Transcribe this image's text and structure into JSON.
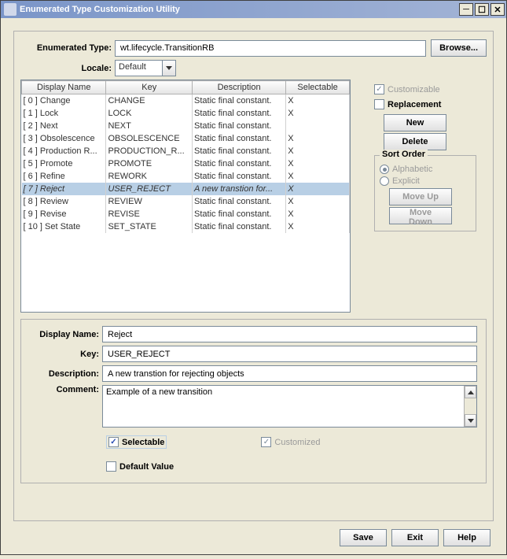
{
  "window": {
    "title": "Enumerated Type Customization Utility"
  },
  "header": {
    "enum_type_label": "Enumerated Type:",
    "enum_type_value": "wt.lifecycle.TransitionRB",
    "browse_label": "Browse...",
    "locale_label": "Locale:",
    "locale_value": "Default"
  },
  "table": {
    "columns": [
      "Display Name",
      "Key",
      "Description",
      "Selectable"
    ],
    "rows": [
      {
        "idx": "0",
        "dn": "Change",
        "key": "CHANGE",
        "desc": "Static final constant.",
        "sel": "X"
      },
      {
        "idx": "1",
        "dn": "Lock",
        "key": "LOCK",
        "desc": "Static final constant.",
        "sel": "X"
      },
      {
        "idx": "2",
        "dn": "Next",
        "key": "NEXT",
        "desc": "Static final constant.",
        "sel": ""
      },
      {
        "idx": "3",
        "dn": "Obsolescence",
        "key": "OBSOLESCENCE",
        "desc": "Static final constant.",
        "sel": "X"
      },
      {
        "idx": "4",
        "dn": "Production R...",
        "key": "PRODUCTION_R...",
        "desc": "Static final constant.",
        "sel": "X"
      },
      {
        "idx": "5",
        "dn": "Promote",
        "key": "PROMOTE",
        "desc": "Static final constant.",
        "sel": "X"
      },
      {
        "idx": "6",
        "dn": "Refine",
        "key": "REWORK",
        "desc": "Static final constant.",
        "sel": "X"
      },
      {
        "idx": "7",
        "dn": "Reject",
        "key": "USER_REJECT",
        "desc": "A new transtion for...",
        "sel": "X"
      },
      {
        "idx": "8",
        "dn": "Review",
        "key": "REVIEW",
        "desc": "Static final constant.",
        "sel": "X"
      },
      {
        "idx": "9",
        "dn": "Revise",
        "key": "REVISE",
        "desc": "Static final constant.",
        "sel": "X"
      },
      {
        "idx": "10",
        "dn": "Set State",
        "key": "SET_STATE",
        "desc": "Static final constant.",
        "sel": "X"
      }
    ],
    "selected_index": 7
  },
  "side": {
    "customizable_label": "Customizable",
    "customizable_checked": true,
    "replacement_label": "Replacement",
    "replacement_checked": false,
    "new_label": "New",
    "delete_label": "Delete",
    "sort_title": "Sort Order",
    "alphabetic_label": "Alphabetic",
    "explicit_label": "Explicit",
    "moveup_label": "Move Up",
    "movedown_label": "Move Down"
  },
  "detail": {
    "display_name_label": "Display Name:",
    "display_name_value": "Reject",
    "key_label": "Key:",
    "key_value": "USER_REJECT",
    "description_label": "Description:",
    "description_value": "A new transtion for rejecting objects",
    "comment_label": "Comment:",
    "comment_value": "Example of a new transition",
    "selectable_label": "Selectable",
    "selectable_checked": true,
    "customized_label": "Customized",
    "customized_checked": true,
    "default_value_label": "Default Value",
    "default_value_checked": false
  },
  "footer": {
    "save_label": "Save",
    "exit_label": "Exit",
    "help_label": "Help"
  }
}
